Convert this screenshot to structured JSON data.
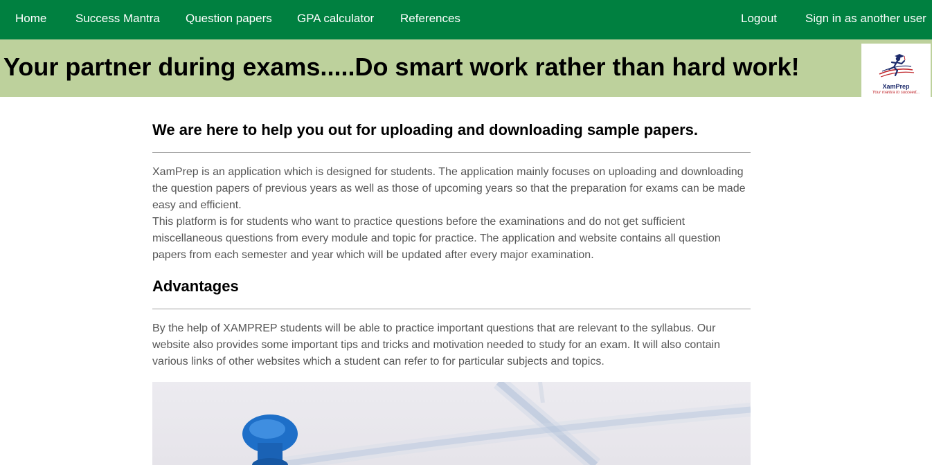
{
  "nav": {
    "left_items": [
      "Home",
      "Success Mantra",
      "Question papers",
      "GPA calculator",
      "References"
    ],
    "right_items": [
      "Logout",
      "Sign in as another user"
    ]
  },
  "banner": {
    "tagline": "Your partner during exams.....Do smart work rather than hard work!",
    "logo_name": "XamPrep",
    "logo_tagline": "Your mantra to succeed..."
  },
  "main": {
    "heading": "We are here to help you out for uploading and downloading sample papers.",
    "intro_paragraph": "XamPrep is an application which is designed for students. The application mainly focuses on uploading and downloading the question papers of previous years as well as those of upcoming years so that the preparation for exams can be made easy and efficient.",
    "platform_paragraph": "This platform is for students who want to practice questions before the examinations and do not get sufficient miscellaneous questions from every module and topic for practice. The application and website contains all question papers from each semester and year which will be updated after every major examination.",
    "advantages_heading": "Advantages",
    "advantages_paragraph": "By the help of XAMPREP students will be able to practice important questions that are relevant to the syllabus. Our website also provides some important tips and tricks and motivation needed to study for an exam. It will also contain various links of other websites which a student can refer to for particular subjects and topics."
  },
  "colors": {
    "nav_bg": "#008040",
    "banner_bg": "#bdd19c",
    "body_text": "#555555",
    "pin_blue": "#1e6fc8"
  },
  "icons": {
    "logo": "runner-logo-icon",
    "hero": "blue-pushpin-image"
  }
}
